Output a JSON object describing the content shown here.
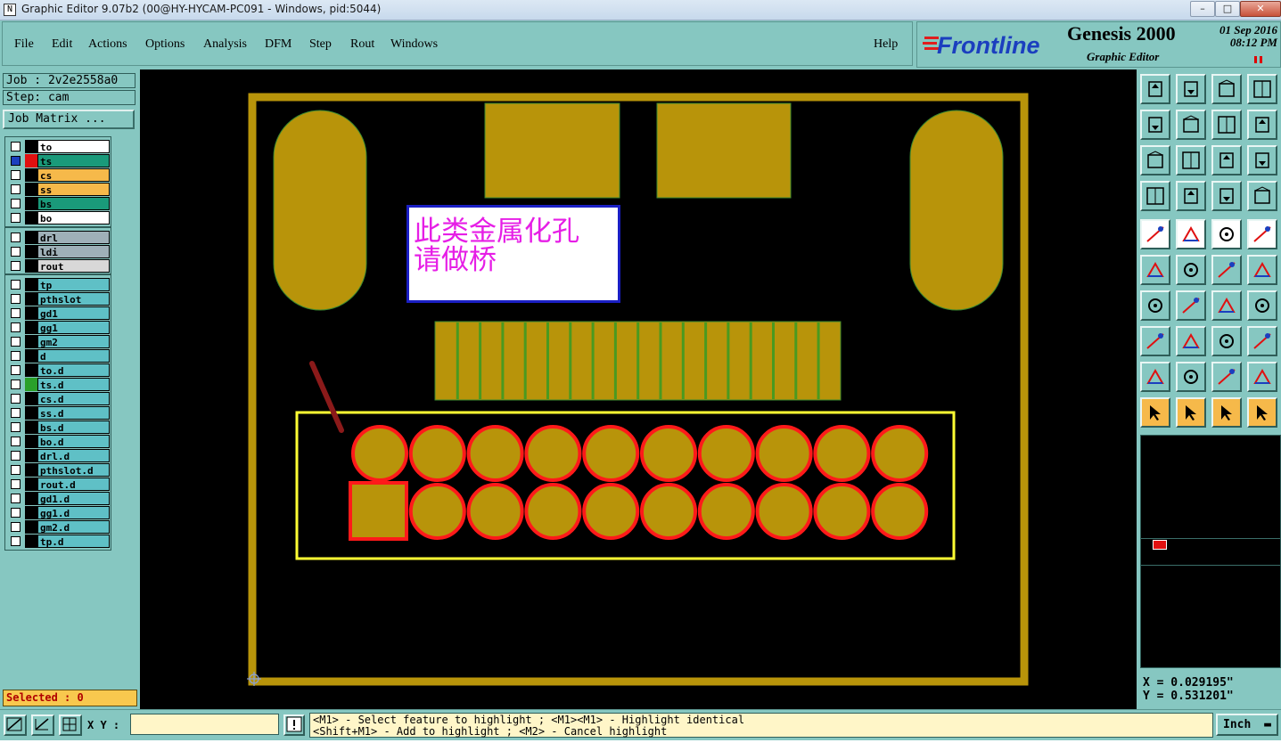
{
  "window": {
    "title": "Graphic Editor 9.07b2 (00@HY-HYCAM-PC091 - Windows, pid:5044)",
    "app_icon": "N"
  },
  "menu": [
    "File",
    "Edit",
    "Actions",
    "Options",
    "Analysis",
    "DFM",
    "Step",
    "Rout",
    "Windows"
  ],
  "help_label": "Help",
  "brand": {
    "logo": "Frontline",
    "product": "Genesis 2000",
    "subtitle": "Graphic Editor",
    "date": "01 Sep 2016",
    "time": "08:12 PM"
  },
  "job": {
    "job_label": "Job : 2v2e2558a0",
    "step_label": "Step: cam",
    "matrix_button": "Job Matrix ..."
  },
  "layers_group1": [
    {
      "name": "to",
      "marker": "#000000",
      "bg": "#ffffff"
    },
    {
      "name": "ts",
      "marker": "#e01010",
      "bg": "#1a9a7a",
      "active": true
    },
    {
      "name": "cs",
      "marker": "#000000",
      "bg": "#f6b94a"
    },
    {
      "name": "ss",
      "marker": "#000000",
      "bg": "#f6b94a"
    },
    {
      "name": "bs",
      "marker": "#000000",
      "bg": "#1a9a7a"
    },
    {
      "name": "bo",
      "marker": "#000000",
      "bg": "#ffffff"
    }
  ],
  "layers_group2": [
    {
      "name": "drl",
      "marker": "#000000",
      "bg": "#9fb0b8"
    },
    {
      "name": "ldi",
      "marker": "#000000",
      "bg": "#9fb0b8"
    },
    {
      "name": "rout",
      "marker": "#000000",
      "bg": "#d8d8d8"
    }
  ],
  "layers_group3": [
    {
      "name": "tp",
      "marker": "#000000"
    },
    {
      "name": "pthslot",
      "marker": "#000000"
    },
    {
      "name": "gd1",
      "marker": "#000000"
    },
    {
      "name": "gg1",
      "marker": "#000000"
    },
    {
      "name": "gm2",
      "marker": "#000000"
    },
    {
      "name": "d",
      "marker": "#000000"
    },
    {
      "name": "to.d",
      "marker": "#000000"
    },
    {
      "name": "ts.d",
      "marker": "#2aa02a"
    },
    {
      "name": "cs.d",
      "marker": "#000000"
    },
    {
      "name": "ss.d",
      "marker": "#000000"
    },
    {
      "name": "bs.d",
      "marker": "#000000"
    },
    {
      "name": "bo.d",
      "marker": "#000000"
    },
    {
      "name": "drl.d",
      "marker": "#000000"
    },
    {
      "name": "pthslot.d",
      "marker": "#000000"
    },
    {
      "name": "rout.d",
      "marker": "#000000"
    },
    {
      "name": "gd1.d",
      "marker": "#000000"
    },
    {
      "name": "gg1.d",
      "marker": "#000000"
    },
    {
      "name": "gm2.d",
      "marker": "#000000"
    },
    {
      "name": "tp.d",
      "marker": "#000000"
    }
  ],
  "selected_label": "Selected : 0",
  "annotation": {
    "line1": "此类金属化孔",
    "line2": "请做桥"
  },
  "coords": {
    "x": "X = 0.029195\"",
    "y": "Y = 0.531201\""
  },
  "bottom": {
    "xy_label": "X Y :",
    "help_line1": "<M1> - Select feature to highlight ; <M1><M1> - Highlight identical",
    "help_line2": "<Shift+M1> - Add to highlight ; <M2> - Cancel highlight",
    "units": "Inch",
    "status_line": ""
  },
  "colors": {
    "copper": "#b8940a",
    "board_bg": "#000000",
    "panel": "#86c7c1",
    "highlight": "#ff1a1a",
    "selection_box": "#ffff33"
  },
  "toolbar_icons": [
    "zoom-home-icon",
    "zoom-page-icon",
    "zoom-step-icon",
    "zoom-window-icon",
    "pan-left-icon",
    "pan-right-icon",
    "undo-zoom-icon",
    "redraw-icon",
    "fit-icon",
    "center-icon",
    "scale-1-2-icon",
    "help-query-icon",
    "graphic-control-icon",
    "grid-icon",
    "layer-display-icon",
    "layer-display-2-icon",
    "snap-icon",
    "break-icon",
    "ruler-icon",
    "frame-icon",
    "connect-icon",
    "delete-node-icon",
    "add-line-icon",
    "add-line-2-icon",
    "angle-icon",
    "slope-icon",
    "rotate-icon",
    "mirror-icon",
    "pad-icon",
    "line-cut-icon",
    "measure-icon",
    "group-icon",
    "triangle-angle-icon",
    "triangle-up-icon",
    "triangle-check-icon",
    "triangle-move-icon",
    "select-arrow-icon",
    "select-box-icon",
    "select-circle-icon",
    "select-path-icon"
  ]
}
